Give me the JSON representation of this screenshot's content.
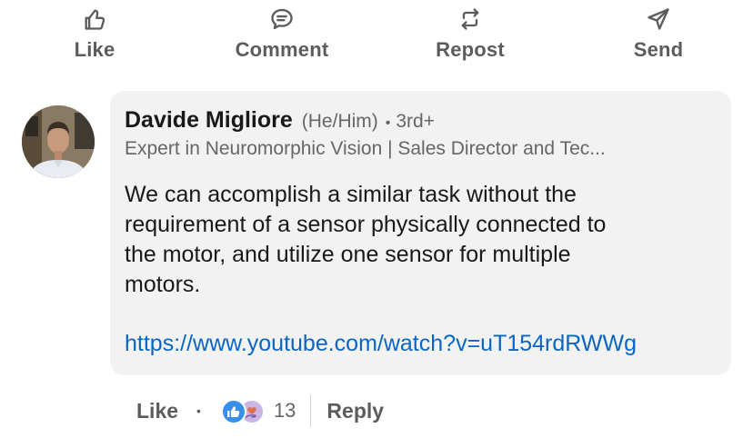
{
  "actions": {
    "like_label": "Like",
    "comment_label": "Comment",
    "repost_label": "Repost",
    "send_label": "Send"
  },
  "comment": {
    "author_name": "Davide Migliore",
    "pronouns": "(He/Him)",
    "separator": "•",
    "connection_degree": "3rd+",
    "headline": "Expert in Neuromorphic Vision | Sales Director and Tec...",
    "text": "We can accomplish a similar task without the\nrequirement of a sensor physically connected to\nthe motor, and utilize one sensor for multiple\nmotors.",
    "link": "https://www.youtube.com/watch?v=uT154rdRWWg"
  },
  "social": {
    "like_label": "Like",
    "separator": "•",
    "reaction_count": "13",
    "reply_label": "Reply",
    "reaction_icons": [
      "like-reaction-icon",
      "love-reaction-icon"
    ]
  },
  "colors": {
    "link": "#0a66c2",
    "bubble": "#f2f2f2",
    "secondary_text": "#666666",
    "action_text": "#5c5c5c",
    "like_reaction": "#378fe9",
    "love_reaction": "#df704d"
  }
}
